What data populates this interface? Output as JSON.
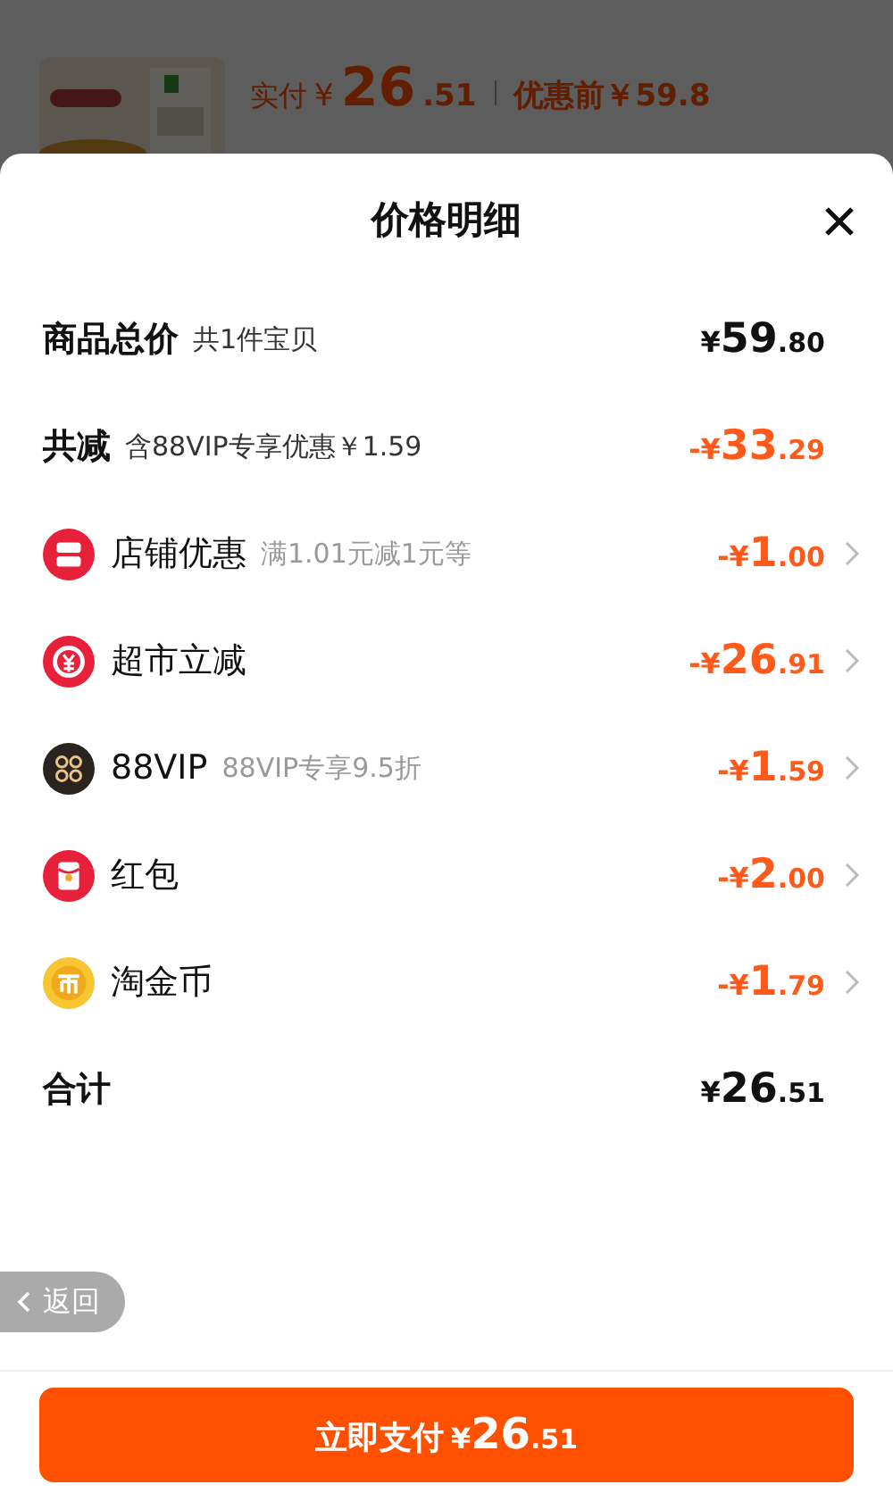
{
  "background_page": {
    "paid_label": "实付",
    "paid_currency": "¥",
    "paid_integer": "26",
    "paid_fraction": ".51",
    "original_price": "优惠前￥59.8"
  },
  "sheet": {
    "title": "价格明细",
    "rows": [
      {
        "kind": "summary",
        "label": "商品总价",
        "note": "共1件宝贝",
        "sign": "¥",
        "integer": "59",
        "fraction": ".80",
        "accent": false
      },
      {
        "kind": "summary",
        "label": "共减",
        "note": "含88VIP专享优惠￥1.59",
        "sign": "-¥",
        "integer": "33",
        "fraction": ".29",
        "accent": true
      },
      {
        "kind": "shop",
        "label": "店铺优惠",
        "note": "满1.01元减1元等",
        "sign": "-¥",
        "integer": "1",
        "fraction": ".00",
        "accent": true
      },
      {
        "kind": "instant",
        "label": "超市立减",
        "sign": "-¥",
        "integer": "26",
        "fraction": ".91",
        "accent": true
      },
      {
        "kind": "vip",
        "label": "88VIP",
        "note": "88VIP专享9.5折",
        "sign": "-¥",
        "integer": "1",
        "fraction": ".59",
        "accent": true
      },
      {
        "kind": "envelope",
        "label": "红包",
        "sign": "-¥",
        "integer": "2",
        "fraction": ".00",
        "accent": true
      },
      {
        "kind": "coin",
        "label": "淘金币",
        "sign": "-¥",
        "integer": "1",
        "fraction": ".79",
        "accent": true
      },
      {
        "kind": "summary",
        "label": "合计",
        "sign": "¥",
        "integer": "26",
        "fraction": ".51",
        "accent": false
      }
    ],
    "back_button": "返回",
    "pay_button": {
      "label": "立即支付",
      "sign": "¥",
      "integer": "26",
      "fraction": ".51"
    }
  }
}
